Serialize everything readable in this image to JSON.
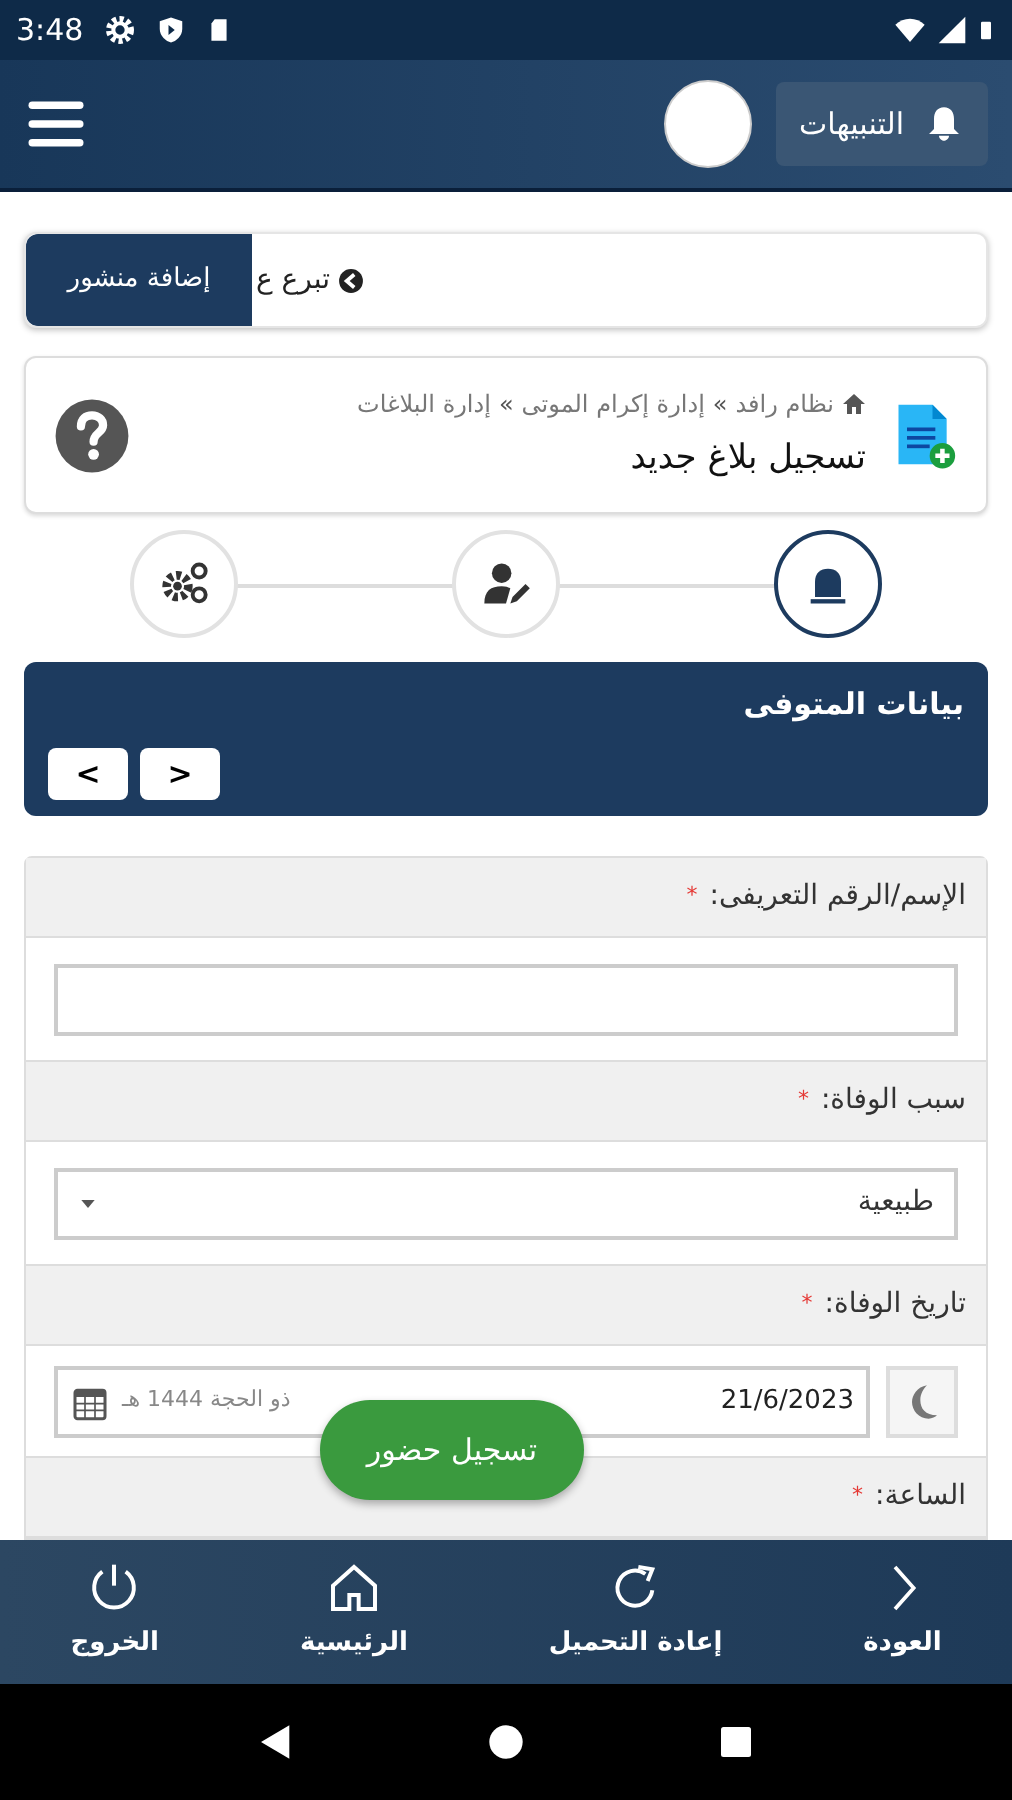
{
  "status_bar": {
    "time": "3:48"
  },
  "header": {
    "notifications_label": "التنبيهات"
  },
  "ticker": {
    "text": "تبرع ع",
    "button": "إضافة منشور"
  },
  "page_header": {
    "breadcrumb": [
      "نظام رافد",
      "إدارة إكرام الموتى",
      "إدارة البلاغات"
    ],
    "separator": "»",
    "title": "تسجيل بلاغ جديد"
  },
  "steps": [
    {
      "kind": "alarm",
      "selected": true
    },
    {
      "kind": "user-edit",
      "selected": false
    },
    {
      "kind": "gears",
      "selected": false
    }
  ],
  "panel": {
    "title": "بيانات المتوفى",
    "prev": "<",
    "next": ">"
  },
  "fields": [
    {
      "kind": "text",
      "label": "الإسم/الرقم التعريفى:",
      "required_mark": "*"
    },
    {
      "kind": "select",
      "label": "سبب الوفاة:",
      "required_mark": "*",
      "value": "طبيعية"
    },
    {
      "kind": "date",
      "label": "تاريخ الوفاة:",
      "required_mark": "*",
      "value": "21/6/2023",
      "hijri": "ذو الحجة 1444 هـ"
    },
    {
      "kind": "label",
      "label": "الساعة:",
      "required_mark": "*"
    }
  ],
  "toast": {
    "label": "تسجيل حضور"
  },
  "bottom_nav": [
    {
      "kind": "back",
      "label": "العودة"
    },
    {
      "kind": "reload",
      "label": "إعادة التحميل"
    },
    {
      "kind": "home",
      "label": "الرئيسية"
    },
    {
      "kind": "power",
      "label": "الخروج"
    }
  ]
}
